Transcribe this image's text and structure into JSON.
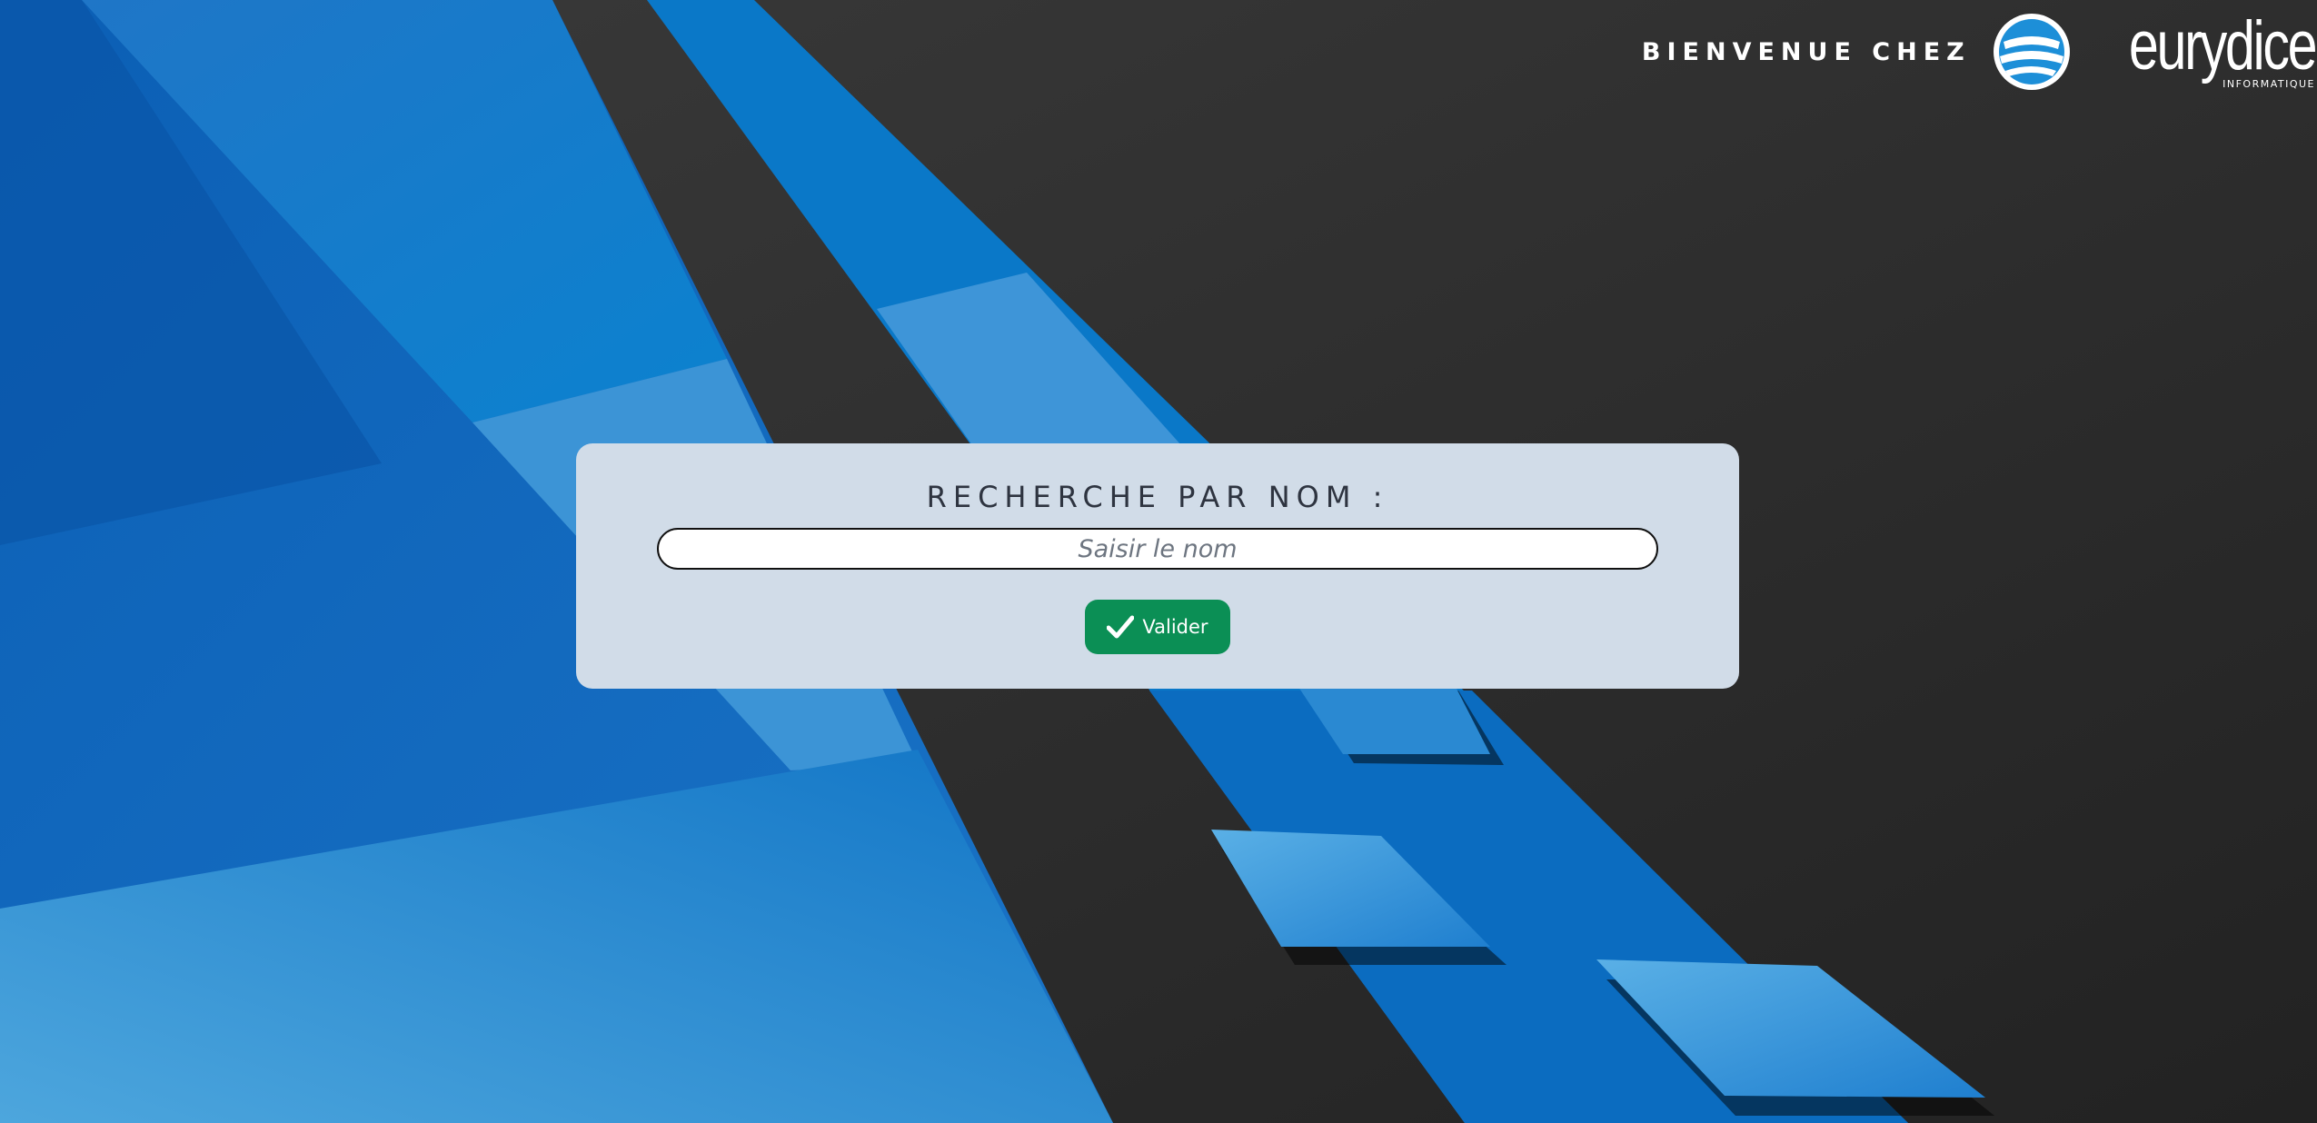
{
  "header": {
    "welcome": "BIENVENUE CHEZ",
    "logo_text": "eurydice",
    "logo_subtext": "INFORMATIQUE"
  },
  "search": {
    "title": "RECHERCHE PAR NOM :",
    "placeholder": "Saisir le nom",
    "value": "",
    "submit_label": "Valider",
    "submit_icon": "check-icon"
  },
  "colors": {
    "card_background": "#d1dce8",
    "button_green": "#0b8f55",
    "background_dark": "#2b2b2b",
    "background_blue": "#1177c9"
  }
}
